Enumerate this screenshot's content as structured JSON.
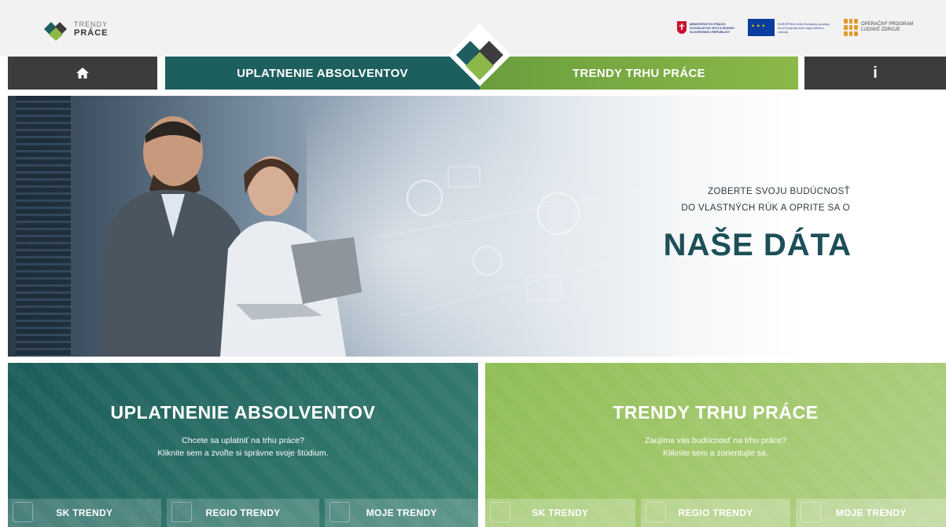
{
  "header": {
    "logo": {
      "line1": "TRENDY",
      "line2": "PRÁCE"
    },
    "sponsors": {
      "ministry": "MINISTERSTVO PRÁCE, SOCIÁLNYCH VECÍ A RODINY SLOVENSKEJ REPUBLIKY",
      "eu": "EURÓPSKA ÚNIA Európsky sociálny fond Európsky fond regionálneho rozvoja",
      "op": "OPERAČNÝ PROGRAM ĽUDSKÉ ZDROJE"
    }
  },
  "nav": {
    "home_icon": "home-icon",
    "graduates": "UPLATNENIE ABSOLVENTOV",
    "trends": "TRENDY TRHU PRÁCE",
    "info": "i"
  },
  "hero": {
    "tagline_line1": "ZOBERTE SVOJU BUDÚCNOSŤ",
    "tagline_line2": "DO VLASTNÝCH RÚK A OPRITE SA O",
    "title": "NAŠE DÁTA"
  },
  "panels": {
    "graduates": {
      "title": "UPLATNENIE ABSOLVENTOV",
      "line1": "Chcete sa uplatniť na trhu práce?",
      "line2": "Kliknite sem a zvoľte si správne svoje štúdium.",
      "subnav": [
        "SK TRENDY",
        "REGIO TRENDY",
        "MOJE TRENDY"
      ]
    },
    "trends": {
      "title": "TRENDY TRHU PRÁCE",
      "line1": "Zaujíma vás budúcnosť na trhu práce?",
      "line2": "Kliknite sem a zorientujte sa.",
      "subnav": [
        "SK TRENDY",
        "REGIO TRENDY",
        "MOJE TRENDY"
      ]
    }
  },
  "colors": {
    "dark_teal": "#1d5f5e",
    "green": "#8cb84a",
    "dark_gray": "#3c3c3c",
    "title_teal": "#1d4f58"
  }
}
